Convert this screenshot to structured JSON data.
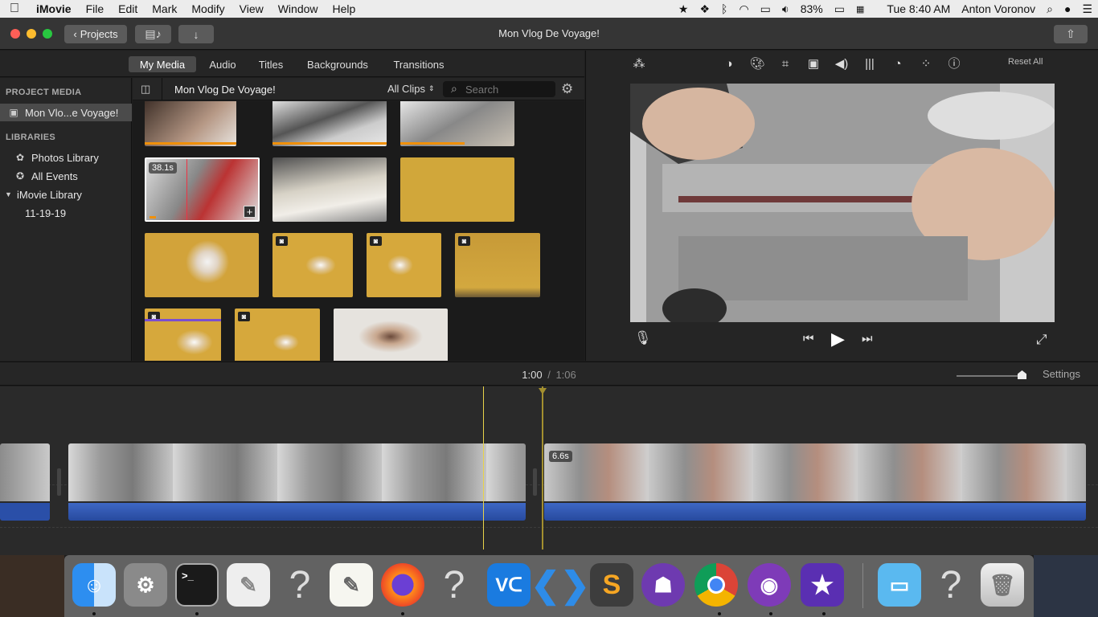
{
  "menubar": {
    "app": "iMovie",
    "items": [
      "File",
      "Edit",
      "Mark",
      "Modify",
      "View",
      "Window",
      "Help"
    ],
    "battery": "83%",
    "clock": "Tue 8:40 AM",
    "user": "Anton Voronov"
  },
  "titlebar": {
    "projects_label": "Projects",
    "title": "Mon Vlog De Voyage!"
  },
  "tabs": [
    "My Media",
    "Audio",
    "Titles",
    "Backgrounds",
    "Transitions"
  ],
  "sidebar": {
    "project_media_header": "PROJECT MEDIA",
    "project_item": "Mon Vlo...e Voyage!",
    "libraries_header": "LIBRARIES",
    "photos_library": "Photos Library",
    "all_events": "All Events",
    "imovie_library": "iMovie Library",
    "event": "11-19-19"
  },
  "media_header": {
    "title": "Mon Vlog De Voyage!",
    "filter": "All Clips",
    "search_placeholder": "Search"
  },
  "selected_clip_duration": "38.1s",
  "viewer": {
    "reset_all": "Reset All"
  },
  "timeline": {
    "current_time": "1:00",
    "separator": "/",
    "total_time": "1:06",
    "settings": "Settings",
    "clip2_duration": "6.6s"
  },
  "dock": {
    "apps": [
      "Finder",
      "System Preferences",
      "Terminal",
      "Script Editor",
      "Unknown",
      "TextEdit",
      "Firefox",
      "Unknown",
      "VNC Viewer",
      "Visual Studio Code",
      "Sublime Text",
      "GitHub Desktop",
      "Google Chrome",
      "Tor Browser",
      "iMovie",
      "Downloads",
      "Unknown",
      "Trash"
    ]
  },
  "colors": {
    "accent_orange": "#f0900a",
    "playhead_yellow": "#e8d34a",
    "audio_blue": "#2a4fa8"
  }
}
